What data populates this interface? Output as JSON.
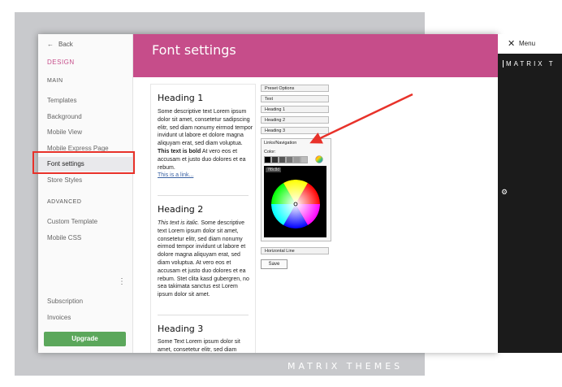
{
  "watermark": "MATRIX THEMES",
  "sidebar": {
    "back_label": "Back",
    "section_title": "DESIGN",
    "main_heading": "MAIN",
    "main_items": [
      "Templates",
      "Background",
      "Mobile View",
      "Mobile Express Page",
      "Font settings",
      "Store Styles"
    ],
    "advanced_heading": "ADVANCED",
    "advanced_items": [
      "Custom Template",
      "Mobile CSS"
    ],
    "more_icon": "⋮",
    "bottom_items": [
      "Subscription",
      "Invoices"
    ],
    "upgrade_label": "Upgrade"
  },
  "header": {
    "title": "Font settings"
  },
  "preview": {
    "heading1": "Heading 1",
    "para1_a": "Some descriptive text Lorem ipsum dolor sit amet, consetetur sadipscing elitr, sed diam nonumy eirmod tempor invidunt ut labore et dolore magna aliquyam erat, sed diam voluptua.",
    "para1_bold": "This text is bold",
    "para1_b": "At vero eos et accusam et justo duo dolores et ea rebum.",
    "link": "This is a link...",
    "heading2": "Heading 2",
    "para2_italic": "This text is italic.",
    "para2_b": "Some descriptive text Lorem ipsum dolor sit amet, consetetur elitr, sed diam nonumy eirmod tempor invidunt ut labore et dolore magna aliquyam erat, sed diam voluptua. At vero eos et accusam et justo duo dolores et ea rebum. Stet clita kasd gubergren, no sea takimata sanctus est Lorem ipsum dolor sit amet.",
    "heading3": "Heading 3",
    "para3": "Some Text Lorem ipsum dolor sit amet, consetetur elitr, sed diam"
  },
  "panel": {
    "buttons": [
      "Preset Options",
      "Text",
      "Heading 1",
      "Heading 2",
      "Heading 3"
    ],
    "links_label": "Links/Navigation",
    "color_label": "Color:",
    "swatches": [
      "#000000",
      "#333333",
      "#555555",
      "#777777",
      "#999999",
      "#bbbbbb"
    ],
    "hex_value": "7f8c8d",
    "horizontal_line": "Horizontal Line",
    "save_label": "Save"
  },
  "right_panel": {
    "close_icon": "✕",
    "menu_label": "Menu",
    "brand": "MATRIX T"
  },
  "colors": {
    "accent": "#c64d8a",
    "upgrade": "#5ba75b",
    "highlight": "#e8322a"
  }
}
